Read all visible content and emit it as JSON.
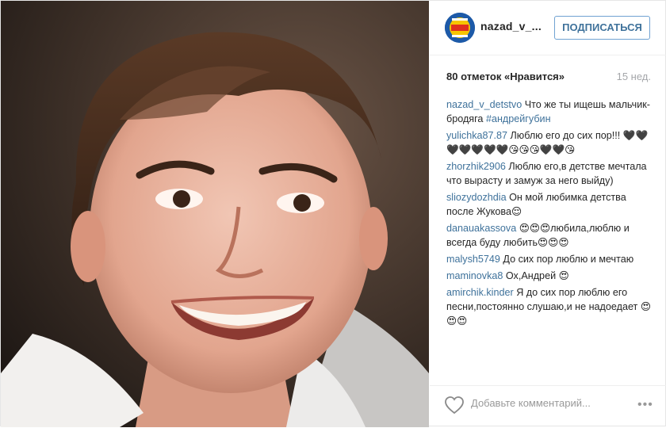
{
  "post": {
    "username": "nazad_v_...",
    "follow_label": "ПОДПИСАТЬСЯ",
    "likes_text": "80 отметок «Нравится»",
    "age_text": "15 нед."
  },
  "comments": [
    {
      "user": "nazad_v_detstvo",
      "text": "Что же ты ищешь мальчик-бродяга ",
      "tag": "#андрейгубин"
    },
    {
      "user": "yulichka87.87",
      "text": "Люблю его до сих пор!!! 🖤🖤🖤🖤🖤🖤🖤😘😘😘🖤🖤😘"
    },
    {
      "user": "zhorzhik2906",
      "text": "Люблю его,в детстве мечтала что вырасту и замуж за него выйду)"
    },
    {
      "user": "sliozydozhdia",
      "text": "Он мой любимка детства после Жукова😌"
    },
    {
      "user": "danauakassova",
      "text": "😍😍😍любила,люблю и всегда буду любить😍😍😍"
    },
    {
      "user": "malysh5749",
      "text": "До сих пор люблю и мечтаю"
    },
    {
      "user": "maminovka8",
      "text": "Ох,Андрей 😍"
    },
    {
      "user": "amirchik.kinder",
      "text": "Я до сих пор люблю его песни,постоянно слушаю,и не надоедает 😍😍😍"
    }
  ],
  "footer": {
    "add_comment_placeholder": "Добавьте комментарий...",
    "more_label": "•••"
  },
  "icons": {
    "like": "heart-outline-icon",
    "more": "ellipsis-icon"
  },
  "colors": {
    "link": "#3f729b",
    "follow_border": "#70a2d2",
    "muted": "#a5a7aa"
  }
}
